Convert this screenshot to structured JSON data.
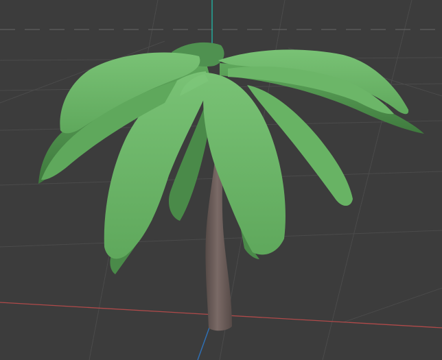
{
  "viewport": {
    "kind": "3d-viewport",
    "background_color": "#3c3c3c",
    "grid_color": "#4b4b4b",
    "horizon_color": "#5a5a5a",
    "x_axis_color": "#b04a4a",
    "y_axis_color": "#2f6fb3",
    "z_axis_color": "#1ec3b0"
  },
  "model": {
    "object": "palm-tree",
    "leaf_color": "#5fa85c",
    "leaf_shadow_color": "#3f7a3e",
    "leaf_highlight_color": "#79c275",
    "trunk_color": "#7a6a66",
    "trunk_shadow_color": "#564a47"
  }
}
